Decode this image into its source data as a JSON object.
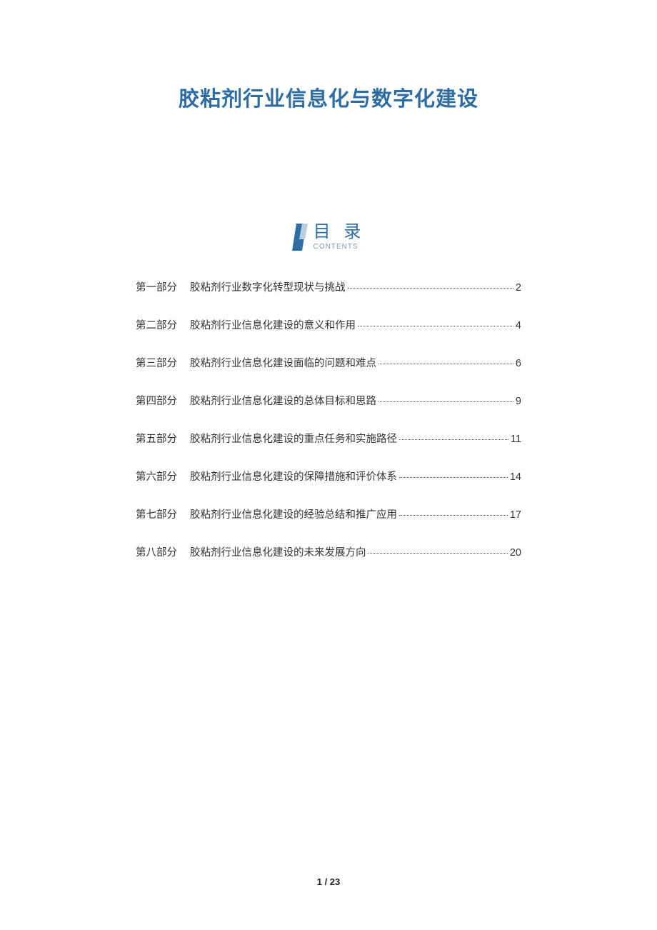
{
  "title": "胶粘剂行业信息化与数字化建设",
  "toc_header": {
    "cn": "目 录",
    "en": "CONTENTS"
  },
  "toc": [
    {
      "part": "第一部分",
      "title": "胶粘剂行业数字化转型现状与挑战",
      "page": "2"
    },
    {
      "part": "第二部分",
      "title": "胶粘剂行业信息化建设的意义和作用",
      "page": "4"
    },
    {
      "part": "第三部分",
      "title": "胶粘剂行业信息化建设面临的问题和难点",
      "page": "6"
    },
    {
      "part": "第四部分",
      "title": "胶粘剂行业信息化建设的总体目标和思路",
      "page": "9"
    },
    {
      "part": "第五部分",
      "title": "胶粘剂行业信息化建设的重点任务和实施路径",
      "page": "11"
    },
    {
      "part": "第六部分",
      "title": "胶粘剂行业信息化建设的保障措施和评价体系",
      "page": "14"
    },
    {
      "part": "第七部分",
      "title": "胶粘剂行业信息化建设的经验总结和推广应用",
      "page": "17"
    },
    {
      "part": "第八部分",
      "title": "胶粘剂行业信息化建设的未来发展方向",
      "page": "20"
    }
  ],
  "footer": {
    "current": "1",
    "sep": " / ",
    "total": "23"
  }
}
